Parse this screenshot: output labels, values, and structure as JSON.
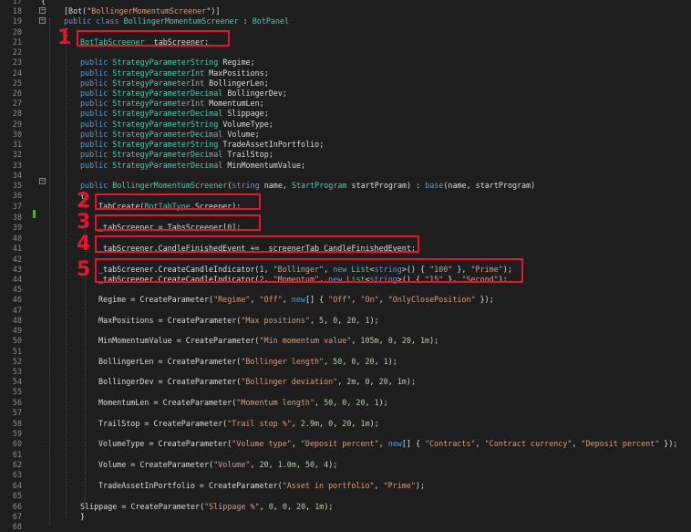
{
  "editor": {
    "line_numbers": [
      "17",
      "18",
      "19",
      "20",
      "21",
      "22",
      "23",
      "24",
      "25",
      "26",
      "27",
      "28",
      "29",
      "30",
      "31",
      "32",
      "33",
      "34",
      "35",
      "36",
      "37",
      "38",
      "39",
      "40",
      "41",
      "42",
      "43",
      "44",
      "45",
      "46",
      "47",
      "48",
      "49",
      "50",
      "51",
      "52",
      "53",
      "54",
      "55",
      "56",
      "57",
      "58",
      "59",
      "60",
      "61",
      "62",
      "63",
      "64",
      "65",
      "66",
      "67",
      "68"
    ],
    "fold_markers": [
      "−",
      "−",
      "−"
    ],
    "lines": [
      [
        [
          "pl",
          "{"
        ]
      ],
      [
        [
          "pl",
          "[Bot(\""
        ],
        [
          "st",
          "BollingerMomentumScreener"
        ],
        [
          "pl",
          "\")]"
        ]
      ],
      [
        [
          "kw",
          "public class "
        ],
        [
          "ty",
          "BollingerMomentumScreener"
        ],
        [
          "pl",
          " : "
        ],
        [
          "ty",
          "BotPanel"
        ]
      ],
      [
        [
          "pl",
          "{"
        ]
      ],
      [
        [
          "ty",
          "BotTabScreener"
        ],
        [
          "pl",
          " _tabScreener;"
        ]
      ],
      [],
      [
        [
          "kw",
          "public "
        ],
        [
          "ty",
          "StrategyParameterString"
        ],
        [
          "pl",
          " Regime;"
        ]
      ],
      [
        [
          "kw",
          "public "
        ],
        [
          "ty",
          "StrategyParameterInt"
        ],
        [
          "pl",
          " MaxPositions;"
        ]
      ],
      [
        [
          "kw",
          "public "
        ],
        [
          "ty",
          "StrategyParameterInt"
        ],
        [
          "pl",
          " BollingerLen;"
        ]
      ],
      [
        [
          "kw",
          "public "
        ],
        [
          "ty",
          "StrategyParameterDecimal"
        ],
        [
          "pl",
          " BollingerDev;"
        ]
      ],
      [
        [
          "kw",
          "public "
        ],
        [
          "ty",
          "StrategyParameterInt"
        ],
        [
          "pl",
          " MomentumLen;"
        ]
      ],
      [
        [
          "kw",
          "public "
        ],
        [
          "ty",
          "StrategyParameterDecimal"
        ],
        [
          "pl",
          " Slippage;"
        ]
      ],
      [
        [
          "kw",
          "public "
        ],
        [
          "ty",
          "StrategyParameterString"
        ],
        [
          "pl",
          " VolumeType;"
        ]
      ],
      [
        [
          "kw",
          "public "
        ],
        [
          "ty",
          "StrategyParameterDecimal"
        ],
        [
          "pl",
          " Volume;"
        ]
      ],
      [
        [
          "kw",
          "public "
        ],
        [
          "ty",
          "StrategyParameterString"
        ],
        [
          "pl",
          " TradeAssetInPortfolio;"
        ]
      ],
      [
        [
          "kw",
          "public "
        ],
        [
          "ty",
          "StrategyParameterDecimal"
        ],
        [
          "pl",
          " TrailStop;"
        ]
      ],
      [
        [
          "kw",
          "public "
        ],
        [
          "ty",
          "StrategyParameterDecimal"
        ],
        [
          "pl",
          " MinMomentumValue;"
        ]
      ],
      [],
      [
        [
          "kw",
          "public "
        ],
        [
          "ty",
          "BollingerMomentumScreener"
        ],
        [
          "pl",
          "("
        ],
        [
          "kw",
          "string"
        ],
        [
          "pl",
          " name, "
        ],
        [
          "ty",
          "StartProgram"
        ],
        [
          "pl",
          " startProgram) : "
        ],
        [
          "kw",
          "base"
        ],
        [
          "pl",
          "(name, startProgram)"
        ]
      ],
      [
        [
          "pl",
          "{"
        ]
      ],
      [
        [
          "pl",
          "TabCreate("
        ],
        [
          "ty",
          "BotTabType"
        ],
        [
          "pl",
          ".Screener);"
        ]
      ],
      [],
      [
        [
          "pl",
          "_tabScreener = TabsScreener["
        ],
        [
          "nm",
          "0"
        ],
        [
          "pl",
          "];"
        ]
      ],
      [],
      [
        [
          "pl",
          "_tabScreener.CandleFinishedEvent += _screenerTab_CandleFinishedEvent;"
        ]
      ],
      [],
      [
        [
          "pl",
          "_tabScreener.CreateCandleIndicator("
        ],
        [
          "nm",
          "1"
        ],
        [
          "pl",
          ", "
        ],
        [
          "st",
          "\"Bollinger\""
        ],
        [
          "pl",
          ", "
        ],
        [
          "kw",
          "new "
        ],
        [
          "ty",
          "List"
        ],
        [
          "pl",
          "<"
        ],
        [
          "kw",
          "string"
        ],
        [
          "pl",
          ">() { "
        ],
        [
          "st",
          "\"100\""
        ],
        [
          "pl",
          " }, "
        ],
        [
          "st",
          "\"Prime\""
        ],
        [
          "pl",
          ");"
        ]
      ],
      [
        [
          "pl",
          "_tabScreener.CreateCandleIndicator("
        ],
        [
          "nm",
          "2"
        ],
        [
          "pl",
          ", "
        ],
        [
          "st",
          "\"Momentum\""
        ],
        [
          "pl",
          ", "
        ],
        [
          "kw",
          "new "
        ],
        [
          "ty",
          "List"
        ],
        [
          "pl",
          "<"
        ],
        [
          "kw",
          "string"
        ],
        [
          "pl",
          ">() { "
        ],
        [
          "st",
          "\"15\""
        ],
        [
          "pl",
          " }, "
        ],
        [
          "st",
          "\"Second\""
        ],
        [
          "pl",
          ");"
        ]
      ],
      [],
      [
        [
          "pl",
          "Regime = CreateParameter("
        ],
        [
          "st",
          "\"Regime\""
        ],
        [
          "pl",
          ", "
        ],
        [
          "st",
          "\"Off\""
        ],
        [
          "pl",
          ", "
        ],
        [
          "kw",
          "new"
        ],
        [
          "pl",
          "[] { "
        ],
        [
          "st",
          "\"Off\""
        ],
        [
          "pl",
          ", "
        ],
        [
          "st",
          "\"On\""
        ],
        [
          "pl",
          ", "
        ],
        [
          "st",
          "\"OnlyClosePosition\""
        ],
        [
          "pl",
          " });"
        ]
      ],
      [],
      [
        [
          "pl",
          "MaxPositions = CreateParameter("
        ],
        [
          "st",
          "\"Max positions\""
        ],
        [
          "pl",
          ", "
        ],
        [
          "nm",
          "5"
        ],
        [
          "pl",
          ", "
        ],
        [
          "nm",
          "0"
        ],
        [
          "pl",
          ", "
        ],
        [
          "nm",
          "20"
        ],
        [
          "pl",
          ", "
        ],
        [
          "nm",
          "1"
        ],
        [
          "pl",
          ");"
        ]
      ],
      [],
      [
        [
          "pl",
          "MinMomentumValue = CreateParameter("
        ],
        [
          "st",
          "\"Min momentum value\""
        ],
        [
          "pl",
          ", "
        ],
        [
          "nm",
          "105m"
        ],
        [
          "pl",
          ", "
        ],
        [
          "nm",
          "0"
        ],
        [
          "pl",
          ", "
        ],
        [
          "nm",
          "20"
        ],
        [
          "pl",
          ", "
        ],
        [
          "nm",
          "1m"
        ],
        [
          "pl",
          ");"
        ]
      ],
      [],
      [
        [
          "pl",
          "BollingerLen = CreateParameter("
        ],
        [
          "st",
          "\"Bollinger length\""
        ],
        [
          "pl",
          ", "
        ],
        [
          "nm",
          "50"
        ],
        [
          "pl",
          ", "
        ],
        [
          "nm",
          "0"
        ],
        [
          "pl",
          ", "
        ],
        [
          "nm",
          "20"
        ],
        [
          "pl",
          ", "
        ],
        [
          "nm",
          "1"
        ],
        [
          "pl",
          ");"
        ]
      ],
      [],
      [
        [
          "pl",
          "BollingerDev = CreateParameter("
        ],
        [
          "st",
          "\"Bollinger deviation\""
        ],
        [
          "pl",
          ", "
        ],
        [
          "nm",
          "2m"
        ],
        [
          "pl",
          ", "
        ],
        [
          "nm",
          "0"
        ],
        [
          "pl",
          ", "
        ],
        [
          "nm",
          "20"
        ],
        [
          "pl",
          ", "
        ],
        [
          "nm",
          "1m"
        ],
        [
          "pl",
          ");"
        ]
      ],
      [],
      [
        [
          "pl",
          "MomentumLen = CreateParameter("
        ],
        [
          "st",
          "\"Momentum length\""
        ],
        [
          "pl",
          ", "
        ],
        [
          "nm",
          "50"
        ],
        [
          "pl",
          ", "
        ],
        [
          "nm",
          "0"
        ],
        [
          "pl",
          ", "
        ],
        [
          "nm",
          "20"
        ],
        [
          "pl",
          ", "
        ],
        [
          "nm",
          "1"
        ],
        [
          "pl",
          ");"
        ]
      ],
      [],
      [
        [
          "pl",
          "TrailStop = CreateParameter("
        ],
        [
          "st",
          "\"Trail stop %\""
        ],
        [
          "pl",
          ", "
        ],
        [
          "nm",
          "2.9m"
        ],
        [
          "pl",
          ", "
        ],
        [
          "nm",
          "0"
        ],
        [
          "pl",
          ", "
        ],
        [
          "nm",
          "20"
        ],
        [
          "pl",
          ", "
        ],
        [
          "nm",
          "1m"
        ],
        [
          "pl",
          ");"
        ]
      ],
      [],
      [
        [
          "pl",
          "VolumeType = CreateParameter("
        ],
        [
          "st",
          "\"Volume type\""
        ],
        [
          "pl",
          ", "
        ],
        [
          "st",
          "\"Deposit percent\""
        ],
        [
          "pl",
          ", "
        ],
        [
          "kw",
          "new"
        ],
        [
          "pl",
          "[] { "
        ],
        [
          "st",
          "\"Contracts\""
        ],
        [
          "pl",
          ", "
        ],
        [
          "st",
          "\"Contract currency\""
        ],
        [
          "pl",
          ", "
        ],
        [
          "st",
          "\"Deposit percent\""
        ],
        [
          "pl",
          " });"
        ]
      ],
      [],
      [
        [
          "pl",
          "Volume = CreateParameter("
        ],
        [
          "st",
          "\"Volume\""
        ],
        [
          "pl",
          ", "
        ],
        [
          "nm",
          "20"
        ],
        [
          "pl",
          ", "
        ],
        [
          "nm",
          "1.0m"
        ],
        [
          "pl",
          ", "
        ],
        [
          "nm",
          "50"
        ],
        [
          "pl",
          ", "
        ],
        [
          "nm",
          "4"
        ],
        [
          "pl",
          ");"
        ]
      ],
      [],
      [
        [
          "pl",
          "TradeAssetInPortfolio = CreateParameter("
        ],
        [
          "st",
          "\"Asset in portfolio\""
        ],
        [
          "pl",
          ", "
        ],
        [
          "st",
          "\"Prime\""
        ],
        [
          "pl",
          ");"
        ]
      ],
      [],
      [
        [
          "pl",
          "Slippage = CreateParameter("
        ],
        [
          "st",
          "\"Slippage %\""
        ],
        [
          "pl",
          ", "
        ],
        [
          "nm",
          "0"
        ],
        [
          "pl",
          ", "
        ],
        [
          "nm",
          "0"
        ],
        [
          "pl",
          ", "
        ],
        [
          "nm",
          "20"
        ],
        [
          "pl",
          ", "
        ],
        [
          "nm",
          "1m"
        ],
        [
          "pl",
          ");"
        ]
      ],
      [
        [
          "pl",
          "}"
        ]
      ],
      []
    ],
    "annotations": [
      "1",
      "2",
      "3",
      "4",
      "5"
    ]
  },
  "colors": {
    "background": "#1e1e1e",
    "keyword": "#569cd6",
    "type": "#4ec9b0",
    "string": "#d69d85",
    "number": "#b5cea8",
    "plain": "#dcdcdc",
    "line_number": "#8a8a8a",
    "annotation": "#e8142b",
    "change_marker": "#57a64a"
  }
}
